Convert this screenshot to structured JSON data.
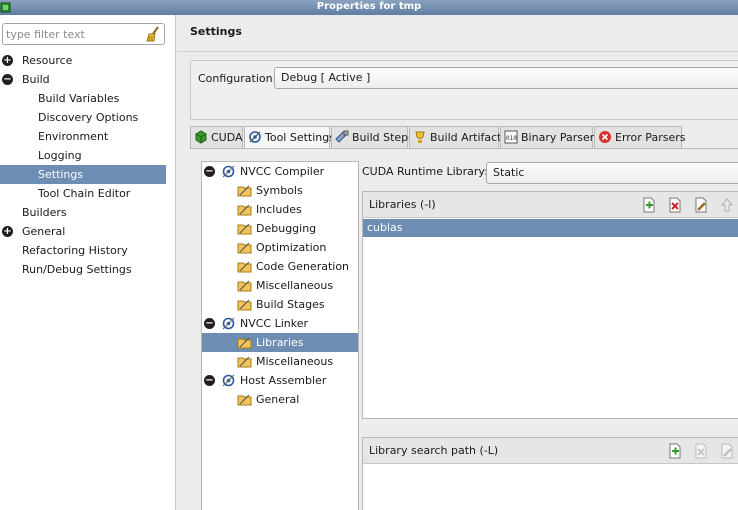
{
  "window": {
    "title": "Properties for tmp"
  },
  "filter": {
    "placeholder": "type filter text"
  },
  "nav": {
    "resource": "Resource",
    "build": "Build",
    "build_variables": "Build Variables",
    "discovery_options": "Discovery Options",
    "environment": "Environment",
    "logging": "Logging",
    "settings": "Settings",
    "tool_chain_editor": "Tool Chain Editor",
    "builders": "Builders",
    "general": "General",
    "refactoring_history": "Refactoring History",
    "run_debug_settings": "Run/Debug Settings"
  },
  "page": {
    "title": "Settings"
  },
  "configuration": {
    "label": "Configuration:",
    "value": "Debug  [ Active ]"
  },
  "tabs": {
    "cuda": "CUDA",
    "tool_settings": "Tool Settings",
    "build_steps": "Build Steps",
    "build_artifact": "Build Artifact",
    "binary_parsers": "Binary Parsers",
    "error_parsers": "Error Parsers"
  },
  "tool_tree": {
    "nvcc_compiler": "NVCC Compiler",
    "symbols": "Symbols",
    "includes": "Includes",
    "debugging": "Debugging",
    "optimization": "Optimization",
    "code_generation": "Code Generation",
    "miscellaneous_compiler": "Miscellaneous",
    "build_stages": "Build Stages",
    "nvcc_linker": "NVCC Linker",
    "libraries": "Libraries",
    "miscellaneous_linker": "Miscellaneous",
    "host_assembler": "Host Assembler",
    "general": "General"
  },
  "runtime": {
    "label": "CUDA Runtime Library:",
    "value": "Static"
  },
  "libraries_panel": {
    "title": "Libraries (-l)",
    "items": [
      "cublas"
    ]
  },
  "search_panel": {
    "title": "Library search path (-L)"
  },
  "colors": {
    "selection": "#6e8db3",
    "titlebar": "#6f8cb0"
  },
  "expander_symbols": {
    "expanded": "−",
    "collapsed": "+"
  }
}
